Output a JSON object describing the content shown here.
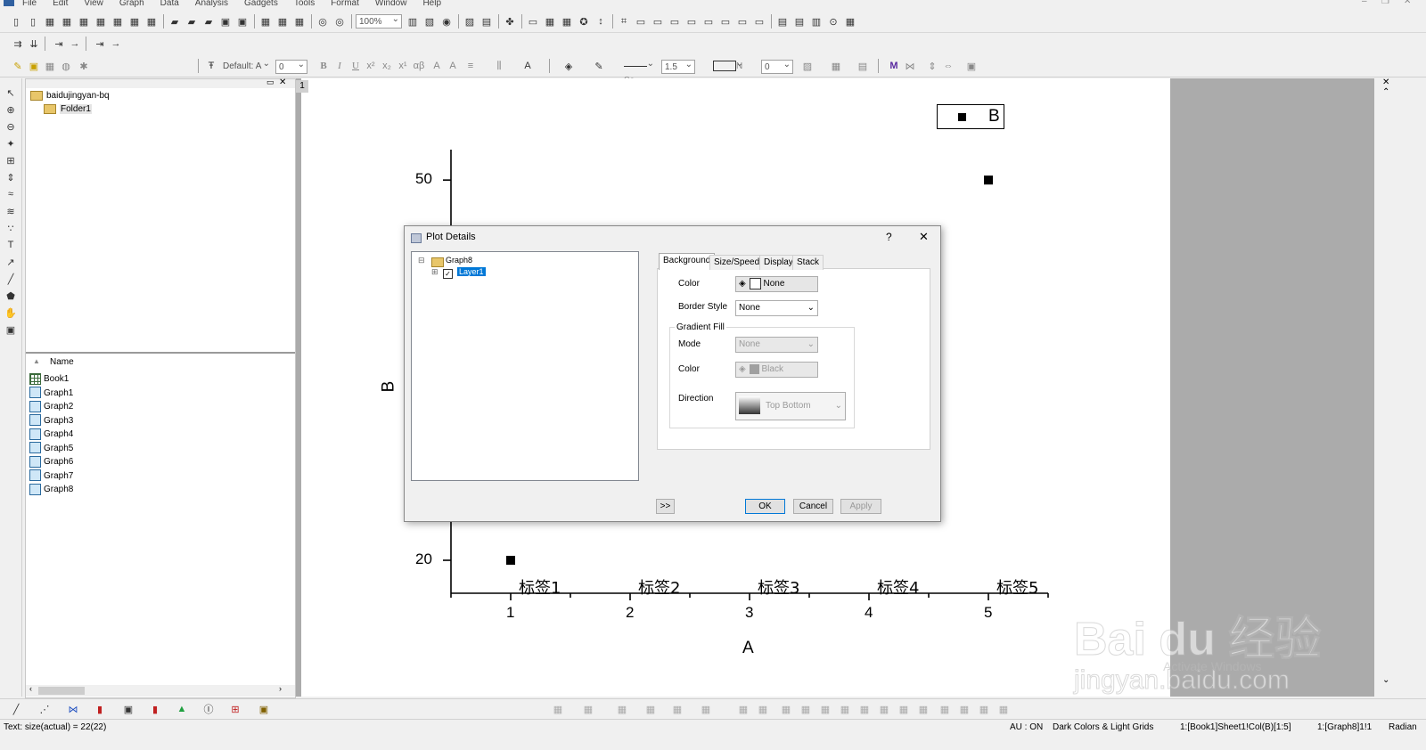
{
  "menu": [
    "File",
    "Edit",
    "View",
    "Graph",
    "Data",
    "Analysis",
    "Gadgets",
    "Tools",
    "Format",
    "Window",
    "Help"
  ],
  "toolbar": {
    "zoom": "100%",
    "font": "Default: A",
    "font_size": "0",
    "line_style": "Sc",
    "line_width": "1.5",
    "fill_label": "N",
    "pattern_value": "0"
  },
  "project": {
    "root": "baidujingyan-bq",
    "folder": "Folder1",
    "list_header": "Name",
    "items": [
      "Book1",
      "Graph1",
      "Graph2",
      "Graph3",
      "Graph4",
      "Graph5",
      "Graph6",
      "Graph7",
      "Graph8"
    ]
  },
  "graph": {
    "page_tab": "1",
    "legend": "B",
    "xlabel": "A",
    "ylabel": "B"
  },
  "chart_data": {
    "type": "scatter",
    "x": [
      1,
      5
    ],
    "y": [
      20,
      50
    ],
    "xticks": [
      1,
      2,
      3,
      4,
      5
    ],
    "yticks_visible": [
      20,
      50
    ],
    "category_labels": [
      "标签1",
      "标签2",
      "标签3",
      "标签4",
      "标签5"
    ],
    "xlabel": "A",
    "ylabel": "B",
    "xlim": [
      0.5,
      5.5
    ],
    "ylim": [
      17.4,
      52.4
    ],
    "legend": [
      "B"
    ],
    "legend_position": "top-right"
  },
  "dialog": {
    "title": "Plot Details",
    "help": "?",
    "close": "✕",
    "tree": {
      "root": "Graph8",
      "child": "Layer1"
    },
    "tabs": [
      "Background",
      "Size/Speed",
      "Display",
      "Stack"
    ],
    "fields": {
      "color_label": "Color",
      "color_value": "None",
      "border_label": "Border Style",
      "border_value": "None",
      "gradient_group": "Gradient Fill",
      "mode_label": "Mode",
      "mode_value": "None",
      "gcolor_label": "Color",
      "gcolor_value": "Black",
      "direction_label": "Direction",
      "direction_value": "Top Bottom"
    },
    "buttons": {
      "expand": ">>",
      "ok": "OK",
      "cancel": "Cancel",
      "apply": "Apply"
    }
  },
  "status": {
    "left": "Text: size(actual) = 22(22)",
    "au": "AU : ON",
    "theme": "Dark Colors & Light Grids",
    "cell": "1:[Book1]Sheet1!Col(B)[1:5]",
    "graph": "1:[Graph8]1!1",
    "angle": "Radian"
  },
  "watermark": {
    "brand": "Bai du 经验",
    "url": "jingyan.baidu.com",
    "activate": "Activate Windows"
  }
}
